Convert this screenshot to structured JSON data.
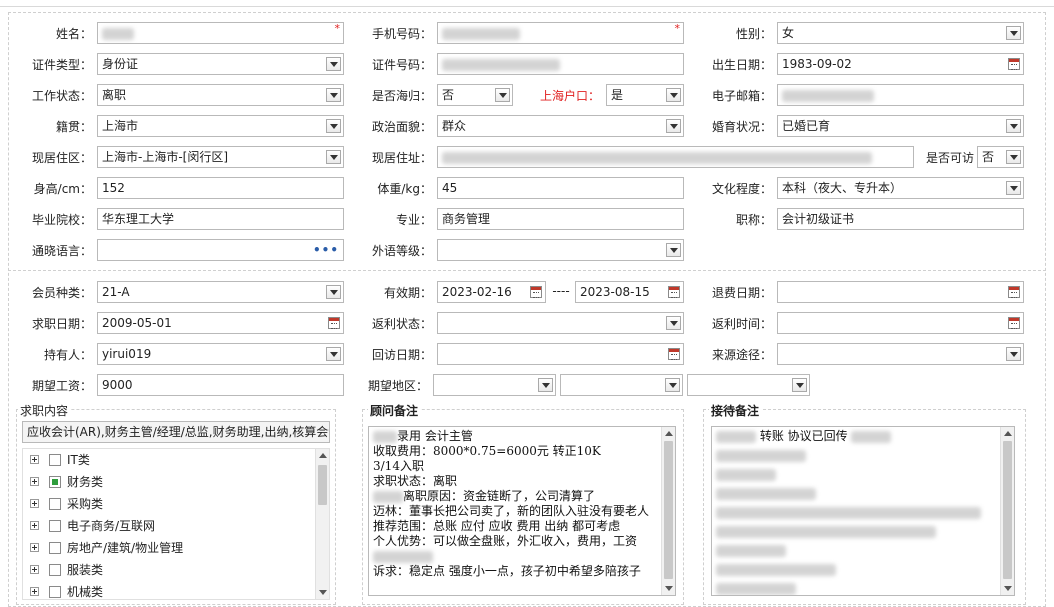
{
  "profile": {
    "name_label": "姓名：",
    "phone_label": "手机号码：",
    "gender_label": "性别：",
    "gender_value": "女",
    "idtype_label": "证件类型：",
    "idtype_value": "身份证",
    "idno_label": "证件号码：",
    "birth_label": "出生日期：",
    "birth_value": "1983-09-02",
    "workstatus_label": "工作状态：",
    "workstatus_value": "离职",
    "overseas_label": "是否海归：",
    "overseas_value": "否",
    "hukou_label": "上海户口：",
    "hukou_value": "是",
    "email_label": "电子邮箱：",
    "native_label": "籍贯：",
    "native_value": "上海市",
    "political_label": "政治面貌：",
    "political_value": "群众",
    "marital_label": "婚育状况：",
    "marital_value": "已婚已育",
    "residence_label": "现居住区：",
    "residence_value": "上海市-上海市-[闵行区]",
    "address_label": "现居住址：",
    "visitable_label": "是否可访",
    "visitable_value": "否",
    "height_label": "身高/cm：",
    "height_value": "152",
    "weight_label": "体重/kg：",
    "weight_value": "45",
    "education_label": "文化程度：",
    "education_value": "本科（夜大、专升本）",
    "school_label": "毕业院校：",
    "school_value": "华东理工大学",
    "major_label": "专业：",
    "major_value": "商务管理",
    "title_label": "职称：",
    "title_value": "会计初级证书",
    "language_label": "通晓语言：",
    "foreign_label": "外语等级：",
    "required_mark": "*",
    "more_icon_text": "•••"
  },
  "membership": {
    "type_label": "会员种类：",
    "type_value": "21-A",
    "valid_label": "有效期：",
    "valid_from": "2023-02-16",
    "valid_sep": "----",
    "valid_to": "2023-08-15",
    "refund_date_label": "退费日期：",
    "job_date_label": "求职日期：",
    "job_date_value": "2009-05-01",
    "rebate_status_label": "返利状态：",
    "rebate_time_label": "返利时间：",
    "holder_label": "持有人：",
    "holder_value": "yirui019",
    "visit_date_label": "回访日期：",
    "source_label": "来源途径：",
    "salary_label": "期望工资：",
    "salary_value": "9000",
    "region_label": "期望地区："
  },
  "job_content": {
    "title": "求职内容",
    "selected_text": "应收会计(AR),财务主管/经理/总监,财务助理,出纳,核算会计",
    "tree": [
      {
        "label": "IT类",
        "state": "unchecked"
      },
      {
        "label": "财务类",
        "state": "partial"
      },
      {
        "label": "采购类",
        "state": "unchecked"
      },
      {
        "label": "电子商务/互联网",
        "state": "unchecked"
      },
      {
        "label": "房地产/建筑/物业管理",
        "state": "unchecked"
      },
      {
        "label": "服装类",
        "state": "unchecked"
      },
      {
        "label": "机械类",
        "state": "unchecked"
      }
    ]
  },
  "advisor_notes": {
    "title": "顾问备注",
    "lines": [
      "录用 会计主管",
      "收取费用：8000*0.75=6000元  转正10K",
      "3/14入职",
      "求职状态：离职",
      "离职原因：资金链断了，公司清算了",
      "迈林：董事长把公司卖了，新的团队入驻没有要老人",
      "推荐范围：总账 应付 应收 费用 出纳 都可考虑",
      "个人优势：可以做全盘账，外汇收入，费用，工资",
      "",
      "诉求：稳定点 强度小一点，孩子初中希望多陪孩子"
    ]
  },
  "reception_notes": {
    "title": "接待备注",
    "first_line": "转账 协议已回传"
  },
  "colors": {
    "required": "#e02020",
    "checkbox_partial": "#2e9d3c",
    "more_icon": "#2a5ca8"
  }
}
